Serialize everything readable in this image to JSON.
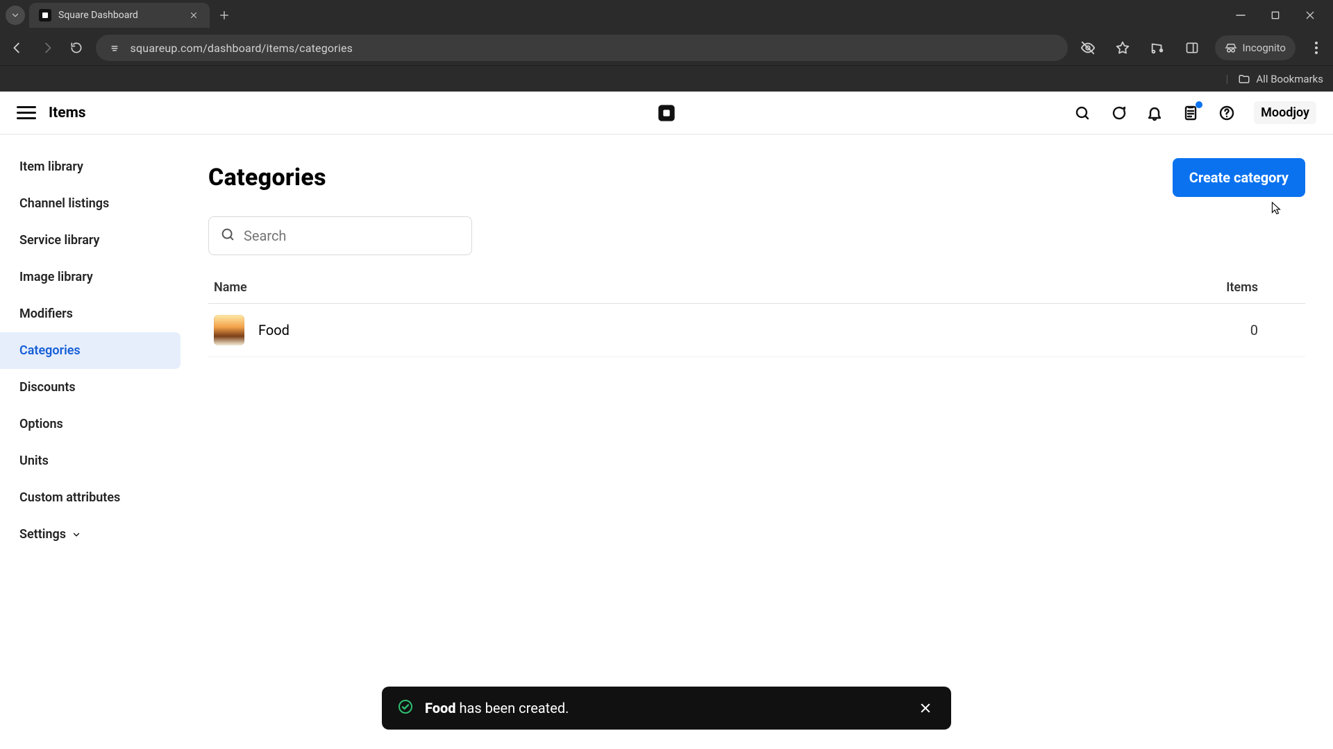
{
  "browser": {
    "tab_title": "Square Dashboard",
    "url": "squareup.com/dashboard/items/categories",
    "incognito_label": "Incognito",
    "all_bookmarks": "All Bookmarks"
  },
  "header": {
    "section": "Items",
    "account_name": "Moodjoy"
  },
  "sidebar": {
    "items": [
      {
        "label": "Item library"
      },
      {
        "label": "Channel listings"
      },
      {
        "label": "Service library"
      },
      {
        "label": "Image library"
      },
      {
        "label": "Modifiers"
      },
      {
        "label": "Categories"
      },
      {
        "label": "Discounts"
      },
      {
        "label": "Options"
      },
      {
        "label": "Units"
      },
      {
        "label": "Custom attributes"
      },
      {
        "label": "Settings"
      }
    ],
    "active_index": 5
  },
  "page": {
    "title": "Categories",
    "create_label": "Create category",
    "search_placeholder": "Search",
    "columns": {
      "name": "Name",
      "items": "Items"
    },
    "rows": [
      {
        "name": "Food",
        "items": "0"
      }
    ]
  },
  "toast": {
    "bold": "Food",
    "rest": " has been created."
  }
}
